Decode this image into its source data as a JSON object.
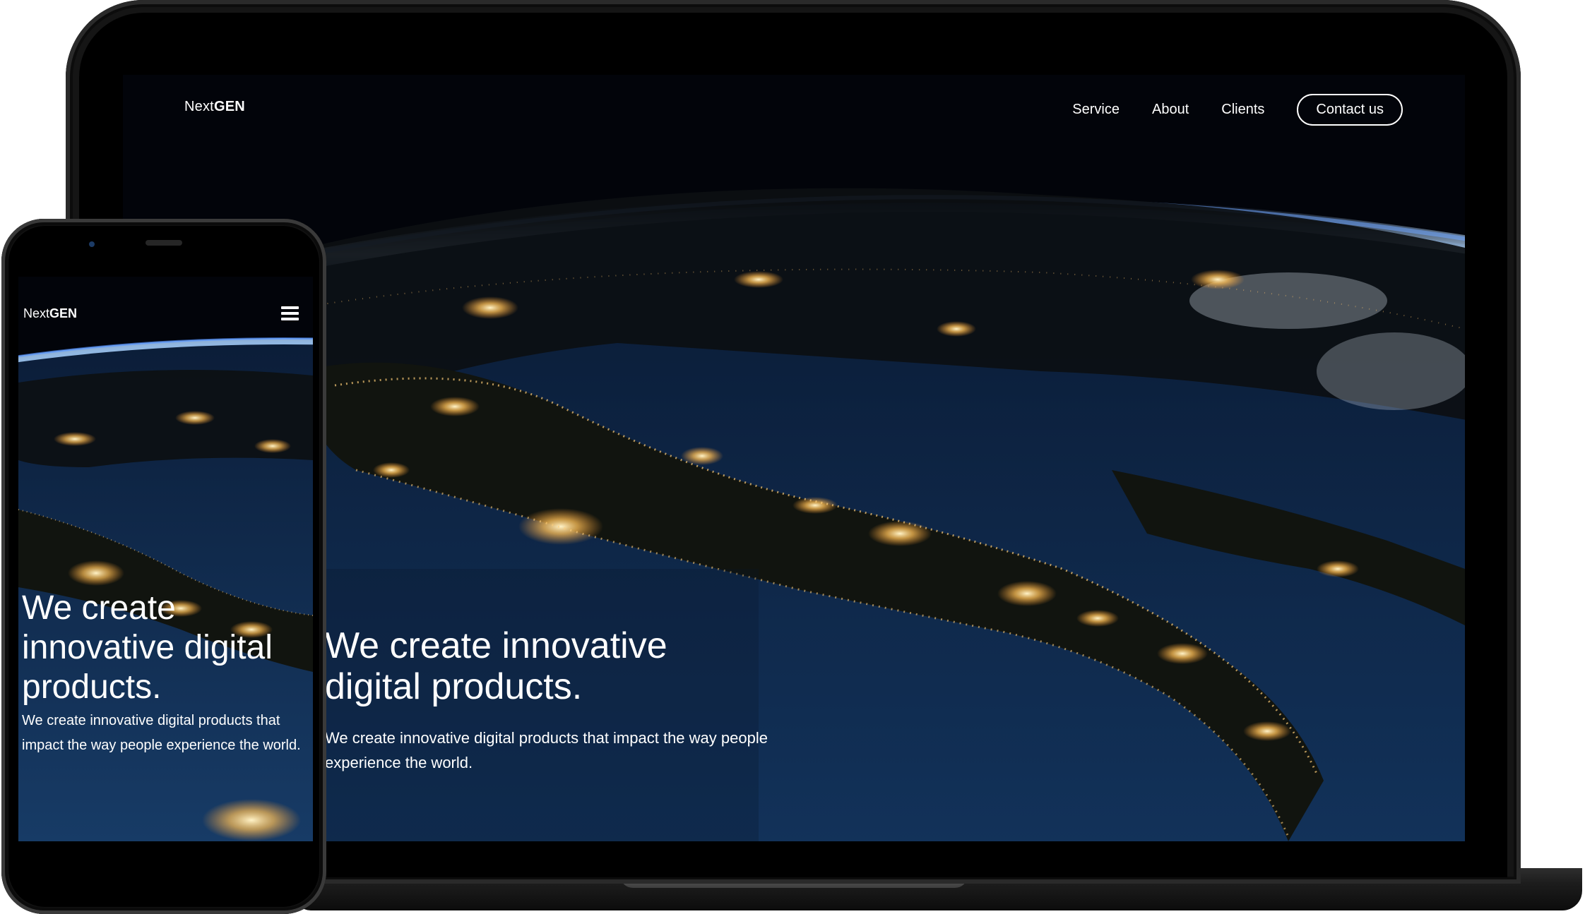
{
  "desktop": {
    "logo": {
      "light": "Next",
      "bold": "GEN"
    },
    "nav": {
      "service": "Service",
      "about": "About",
      "clients": "Clients",
      "contact": "Contact us"
    },
    "hero": {
      "heading_line1": "We create innovative",
      "heading_line2": "digital products.",
      "subtext": "We create innovative digital products that impact the way people experience the world."
    }
  },
  "mobile": {
    "logo": {
      "light": "Next",
      "bold": "GEN"
    },
    "menu_icon": "hamburger-icon",
    "hero": {
      "heading": "We create innovative digital products.",
      "subtext": "We create innovative digital products that impact the way people experience the world."
    }
  },
  "colors": {
    "space": "#02040a",
    "ocean": "#0d2748",
    "land": "#0a0d10",
    "city_lights": "#ffc56a",
    "atmosphere": "#4f8dff"
  }
}
